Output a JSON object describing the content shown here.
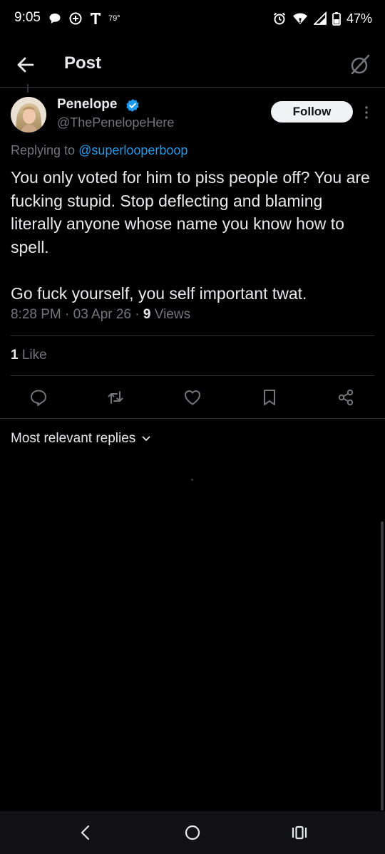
{
  "status_bar": {
    "time": "9:05",
    "temperature": "79°",
    "battery": "47%",
    "icons": [
      "chat-bubble-icon",
      "plus-circle-icon",
      "t-mobile-icon",
      "alarm-icon",
      "wifi-icon",
      "signal-icon",
      "battery-icon"
    ]
  },
  "header": {
    "title": "Post",
    "back_icon": "arrow-left-icon",
    "right_icon": "grok-icon"
  },
  "post": {
    "author_name": "Penelope",
    "handle": "@ThePenelopeHere",
    "follow_label": "Follow",
    "replying_prefix": "Replying to ",
    "replying_to": "@superlooperboop",
    "text": "You only voted for him to piss people off? You are fucking stupid. Stop deflecting and blaming literally anyone whose name you know how to spell.\n\nGo fuck yourself, you self important twat.",
    "time": "8:28 PM",
    "date": "03 Apr 26",
    "views_count": "9",
    "views_label": "Views",
    "likes_count": "1",
    "likes_label": "Like"
  },
  "actions": [
    "reply-icon",
    "repost-icon",
    "like-icon",
    "bookmark-icon",
    "share-icon"
  ],
  "replies": {
    "sort_label": "Most relevant replies"
  },
  "colors": {
    "background": "#000000",
    "text": "#e7e9ea",
    "secondary": "#71767b",
    "accent": "#1d9bf0",
    "divider": "#2f3336"
  }
}
